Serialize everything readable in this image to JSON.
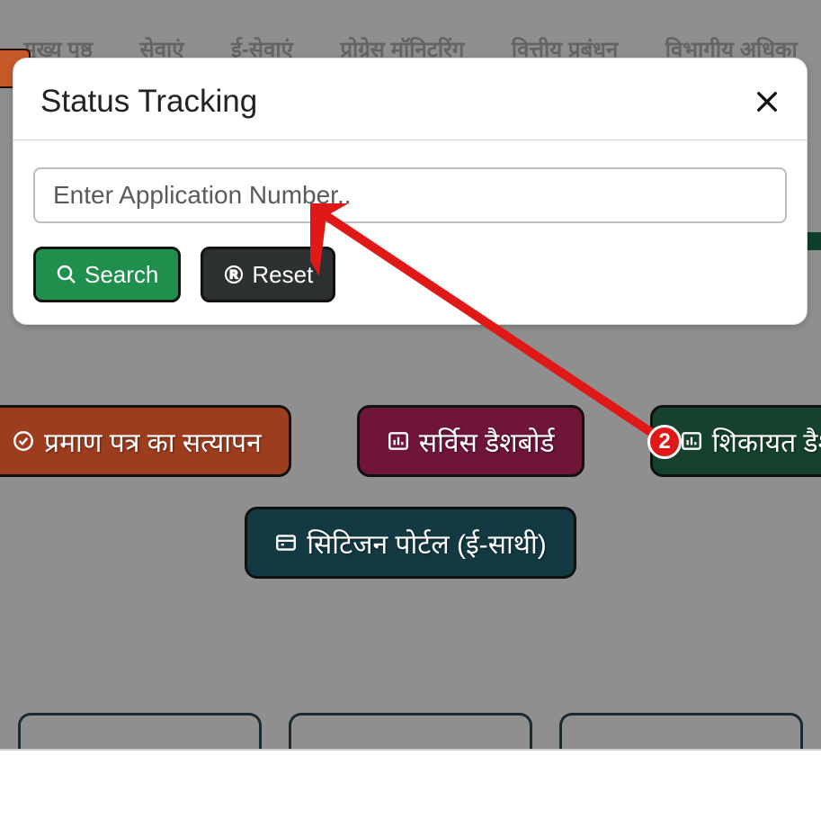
{
  "nav": {
    "items": [
      "मुख्य पृष्ठ",
      "सेवाएं",
      "ई-सेवाएं",
      "प्रोग्रेस मॉनिटरिंग",
      "वित्तीय प्रबंधन",
      "विभागीय अधिका"
    ]
  },
  "modal": {
    "title": "Status Tracking",
    "input_placeholder": "Enter Application Number..",
    "search_label": "Search",
    "reset_label": "Reset"
  },
  "pills": {
    "verify": "प्रमाण पत्र का सत्यापन",
    "service_dashboard": "सर्विस डैशबोर्ड",
    "complaint_dashboard": "शिकायत डैश",
    "citizen_portal": "सिटिजन पोर्टल (ई-साथी)"
  },
  "annotation": {
    "badge": "2"
  }
}
